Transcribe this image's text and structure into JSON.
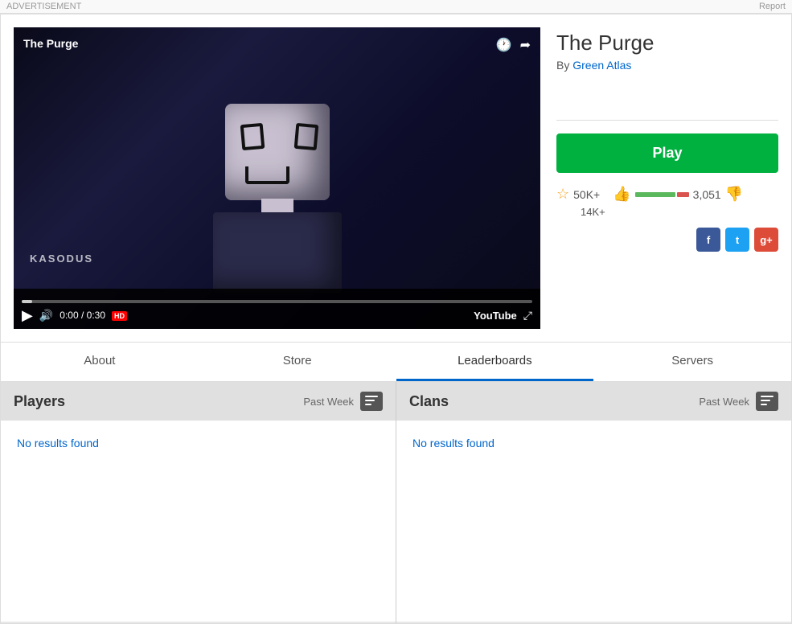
{
  "topBar": {
    "advertisement": "ADVERTISEMENT",
    "report": "Report"
  },
  "game": {
    "title": "The Purge",
    "author_prefix": "By",
    "author": "Green Atlas",
    "play_label": "Play",
    "favorites": "50K+",
    "likes": "14K+",
    "dislikes": "3,051",
    "video": {
      "title": "The Purge",
      "watermark": "KASODUS",
      "time_current": "0:00",
      "time_total": "0:30",
      "time_display": "0:00 / 0:30",
      "hd_label": "HD",
      "youtube_label": "YouTube"
    }
  },
  "tabs": [
    {
      "id": "about",
      "label": "About",
      "active": false
    },
    {
      "id": "store",
      "label": "Store",
      "active": false
    },
    {
      "id": "leaderboards",
      "label": "Leaderboards",
      "active": true
    },
    {
      "id": "servers",
      "label": "Servers",
      "active": false
    }
  ],
  "leaderboard": {
    "players": {
      "title": "Players",
      "period": "Past Week",
      "no_results": "No results found"
    },
    "clans": {
      "title": "Clans",
      "period": "Past Week",
      "no_results": "No results found"
    }
  },
  "social": {
    "facebook": "f",
    "twitter": "t",
    "googleplus": "g+"
  }
}
